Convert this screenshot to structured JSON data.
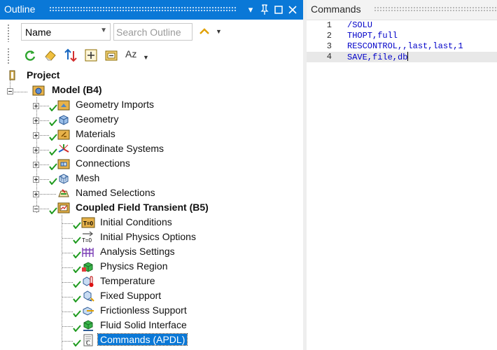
{
  "outline": {
    "title": "Outline",
    "window_buttons": {
      "dropdown": "▾",
      "pin": "📌",
      "maximize": "□",
      "close": "✕"
    },
    "filter_select": {
      "value": "Name"
    },
    "search": {
      "placeholder": "Search Outline"
    },
    "sort_label": "Az",
    "toolbar_icons": [
      "refresh-icon",
      "clear-icon",
      "sort-arrows-icon",
      "expand-icon",
      "collapse-icon",
      "alphabetical-sort-icon"
    ]
  },
  "tree": {
    "project": "Project",
    "model": "Model (B4)",
    "geometry_imports": "Geometry Imports",
    "geometry": "Geometry",
    "materials": "Materials",
    "coordinate_systems": "Coordinate Systems",
    "connections": "Connections",
    "mesh": "Mesh",
    "named_selections": "Named Selections",
    "analysis": "Coupled Field Transient (B5)",
    "initial_conditions": "Initial Conditions",
    "initial_physics_options": "Initial Physics Options",
    "analysis_settings": "Analysis Settings",
    "physics_region": "Physics Region",
    "temperature": "Temperature",
    "fixed_support": "Fixed Support",
    "frictionless_support": "Frictionless Support",
    "fluid_solid_interface": "Fluid Solid Interface",
    "commands_apdl": "Commands (APDL)"
  },
  "commands": {
    "title": "Commands",
    "lines": [
      {
        "num": "1",
        "code": "/SOLU"
      },
      {
        "num": "2",
        "code": "THOPT,full"
      },
      {
        "num": "3",
        "code": "RESCONTROL,,last,last,1"
      },
      {
        "num": "4",
        "code": "SAVE,file,db"
      }
    ]
  },
  "colors": {
    "selection_blue": "#0a78d7",
    "check_green": "#1e9a1e",
    "code_blue": "#0000c8"
  }
}
